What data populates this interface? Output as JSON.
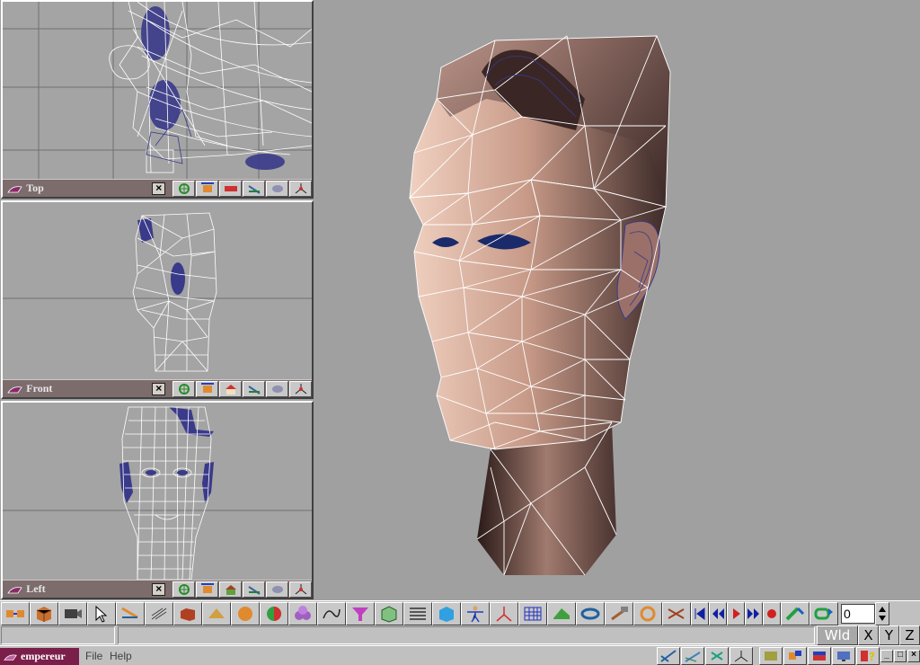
{
  "viewports": {
    "top": {
      "title": "Top"
    },
    "front": {
      "title": "Front"
    },
    "left": {
      "title": "Left"
    },
    "close_glyph": "×"
  },
  "viewport_tools": [
    "move-tool-icon",
    "rotate-tool-icon",
    "scale-tool-icon",
    "pan-tool-icon",
    "zoom-tool-icon",
    "axis-tool-icon"
  ],
  "toolbar": {
    "frame_value": "0",
    "buttons": [
      "snap-icon",
      "cube-icon",
      "camera-icon",
      "select-arrow-icon",
      "move-icon",
      "lattice-icon",
      "box-icon",
      "prism-icon",
      "sphere-icon",
      "material-icon",
      "blob-icon",
      "spline-icon",
      "funnel-icon",
      "cube-faces-icon",
      "list-icon",
      "box-3d-icon",
      "figure-icon",
      "axes-icon",
      "grid-icon",
      "landscape-icon",
      "pipe-icon",
      "hammer-icon",
      "ring-icon",
      "link-icon"
    ],
    "playback": [
      "skip-start-icon",
      "rewind-icon",
      "play-icon",
      "fast-forward-icon",
      "record-icon"
    ]
  },
  "status": {
    "wld": "Wld",
    "x": "X",
    "y": "Y",
    "z": "Z"
  },
  "menubar": {
    "app_name": "empereur",
    "file": "File",
    "help": "Help"
  },
  "colors": {
    "background": "#a0a0a0",
    "titlebar": "#7c6c6c",
    "app_label": "#7a1f4a",
    "wire": "#ffffff",
    "wire_blue": "#3a3a8a",
    "skin": "#c89a88"
  }
}
